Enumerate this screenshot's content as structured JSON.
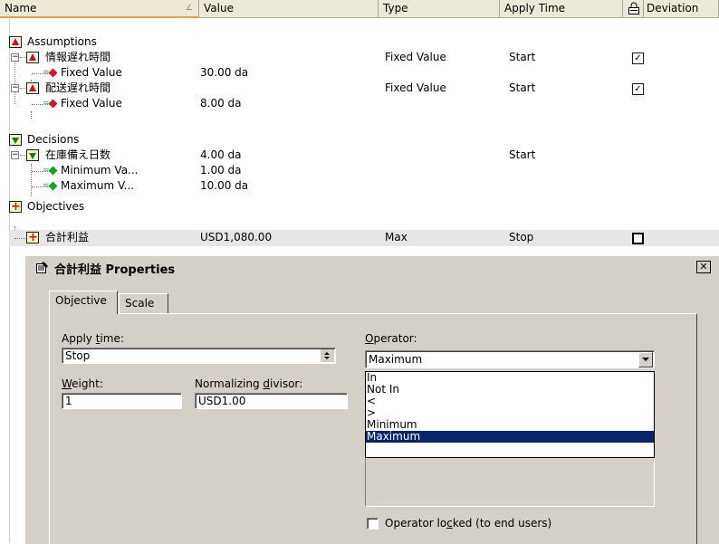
{
  "columns": {
    "name": "Name",
    "value": "Value",
    "type": "Type",
    "apply_time": "Apply Time",
    "lock_icon": "lock-icon",
    "deviation": "Deviation"
  },
  "rows": [
    {
      "name": "Assumptions"
    },
    {
      "name": "情報遅れ時間",
      "type": "Fixed Value",
      "apply_time": "Start",
      "locked": true
    },
    {
      "name": "Fixed Value",
      "value": "30.00 da"
    },
    {
      "name": "配送遅れ時間",
      "type": "Fixed Value",
      "apply_time": "Start",
      "locked": true
    },
    {
      "name": "Fixed Value",
      "value": "8.00 da"
    },
    {
      "name": "Decisions"
    },
    {
      "name": "在庫備え日数",
      "value": "4.00 da",
      "apply_time": "Start"
    },
    {
      "name": "Minimum Va...",
      "value": "1.00 da"
    },
    {
      "name": "Maximum V...",
      "value": "10.00 da"
    },
    {
      "name": "Objectives"
    },
    {
      "name": "合計利益",
      "value": "USD1,080.00",
      "type": "Max",
      "apply_time": "Stop",
      "locked": false
    }
  ],
  "dialog": {
    "title": "合計利益 Properties",
    "tabs": [
      "Objective",
      "Scale"
    ],
    "apply_time": {
      "label_pre": "Apply ",
      "label_u": "t",
      "label_post": "ime:",
      "value": "Stop"
    },
    "weight": {
      "label_u": "W",
      "label_post": "eight:",
      "value": "1"
    },
    "divisor": {
      "label_pre": "Normalizing ",
      "label_u": "d",
      "label_post": "ivisor:",
      "value": "USD1.00"
    },
    "operator": {
      "label_u": "O",
      "label_post": "perator:",
      "value": "Maximum"
    },
    "operator_options": [
      "In",
      "Not In",
      "<",
      ">",
      "Minimum",
      "Maximum"
    ],
    "lock_checkbox": {
      "label_pre": "Operator lo",
      "label_u": "c",
      "label_post": "ked (to end users)",
      "checked": false
    }
  },
  "colors": {
    "selection": "#0a246a",
    "dialog_face": "#d4d0c8",
    "assumption_red": "#c0161d",
    "decision_green": "#1a7a2a"
  }
}
